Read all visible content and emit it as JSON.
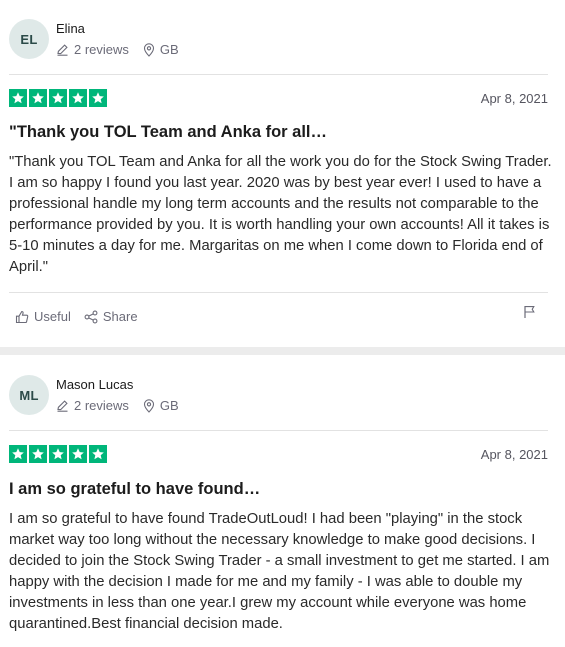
{
  "reviews": [
    {
      "initials": "EL",
      "name": "Elina",
      "review_count": "2 reviews",
      "country": "GB",
      "rating": 5,
      "date": "Apr 8, 2021",
      "title": "\"Thank you TOL Team and Anka for all…",
      "body": "\"Thank you TOL Team and Anka for all the work you do for the Stock Swing Trader. I am so happy I found you last year. 2020 was by best year ever! I used to have a professional handle my long term accounts and the results not comparable to the performance provided by you. It is worth handling your own accounts! All it takes is 5-10 minutes a day for me. Margaritas on me when I come down to Florida end of April.\"",
      "useful_label": "Useful",
      "share_label": "Share"
    },
    {
      "initials": "ML",
      "name": "Mason Lucas",
      "review_count": "2 reviews",
      "country": "GB",
      "rating": 5,
      "date": "Apr 8, 2021",
      "title": "I am so grateful to have found…",
      "body": "I am so grateful to have found TradeOutLoud! I had been \"playing\" in the stock market way too long without the necessary knowledge to make good decisions. I decided to join the Stock Swing Trader - a small investment to get me started. I am happy with the decision I made for me and my family - I was able to double my investments in less than one year.I grew my account while everyone was home quarantined.Best financial decision made."
    }
  ],
  "colors": {
    "star_green": "#00b67a",
    "avatar_bg": "#dfe9e8",
    "meta_gray": "#6b6b78"
  }
}
